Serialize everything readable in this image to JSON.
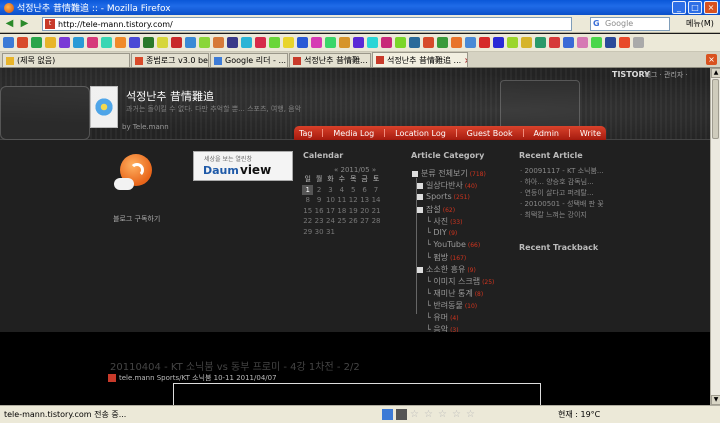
{
  "window": {
    "title": "석정난추 昔情難追 :: - Mozilla Firefox"
  },
  "nav": {
    "url": "http://tele-mann.tistory.com/",
    "search_placeholder": "Google",
    "menu_label": "메뉴(M)"
  },
  "tabs": [
    {
      "label": "(제목 없음)",
      "active": false
    },
    {
      "label": "종범로그 v3.0 bet...",
      "active": false
    },
    {
      "label": "Google 리더 - ...",
      "active": false
    },
    {
      "label": "석정난추 昔情難...",
      "active": false
    },
    {
      "label": "석정난추 昔情難追 ...",
      "active": true
    }
  ],
  "blog": {
    "title": "석정난추 昔情難追",
    "description": "과거는 돌이킬 수 없다. 다만 추억할 뿐... 스포츠, 여행, 음악",
    "owner": "by Tele.mann",
    "brand": "TISTORY",
    "topnav": "· 태그 · 관리자 ·"
  },
  "menu": [
    "Tag",
    "Media Log",
    "Location Log",
    "Guest Book",
    "Admin",
    "Write"
  ],
  "sidebar": {
    "rss_label": "블로그 구독하기",
    "daum_sub": "세상을 보는 열린창",
    "daum_logo": "Daum",
    "daum_view": "view"
  },
  "calendar": {
    "title": "Calendar",
    "month": "« 2011/05 »",
    "weekdays": [
      "일",
      "월",
      "화",
      "수",
      "목",
      "금",
      "토"
    ],
    "weeks": [
      [
        "1",
        "2",
        "3",
        "4",
        "5",
        "6",
        "7"
      ],
      [
        "8",
        "9",
        "10",
        "11",
        "12",
        "13",
        "14"
      ],
      [
        "15",
        "16",
        "17",
        "18",
        "19",
        "20",
        "21"
      ],
      [
        "22",
        "23",
        "24",
        "25",
        "26",
        "27",
        "28"
      ],
      [
        "29",
        "30",
        "31",
        "",
        "",
        "",
        ""
      ]
    ]
  },
  "category": {
    "title": "Article Category",
    "items": [
      {
        "label": "분류 전체보기",
        "count": "(718)"
      },
      {
        "label": "일상다반사",
        "count": "(40)"
      },
      {
        "label": "Sports",
        "count": "(251)"
      },
      {
        "label": "잡설",
        "count": "(62)"
      },
      {
        "label": "사진",
        "count": "(33)"
      },
      {
        "label": "DIY",
        "count": "(9)"
      },
      {
        "label": "YouTube",
        "count": "(66)"
      },
      {
        "label": "펌방",
        "count": "(167)"
      },
      {
        "label": "소소한 흥유",
        "count": "(9)"
      },
      {
        "label": "이미지 스크랩",
        "count": "(25)"
      },
      {
        "label": "재미난 통계",
        "count": "(8)"
      },
      {
        "label": "반려동물",
        "count": "(10)"
      },
      {
        "label": "유머",
        "count": "(4)"
      },
      {
        "label": "음악",
        "count": "(3)"
      }
    ]
  },
  "recent_article": {
    "title": "Recent Article",
    "items": [
      "· 20091117 - KT 소닉붐...",
      "· 하아... 양승호 감독님...",
      "· 연등이 살다고 퍼레탈...",
      "· 20100501 - 성택배 판 꽃",
      "· 최택칼 느껴는 강이지"
    ]
  },
  "recent_trackback": {
    "title": "Recent Trackback"
  },
  "post": {
    "title": "20110404 - KT 소닉붐 vs 동부 프로미 - 4강 1차전 - 2/2",
    "meta": "tele.mann Sports/KT 소닉붐 10-11 2011/04/07"
  },
  "status": {
    "text": "tele-mann.tistory.com 전송 중...",
    "weather": "현재 : 19°C"
  },
  "colors": {
    "accent_red": "#c8321e",
    "titlebar": "#0a57d8"
  }
}
